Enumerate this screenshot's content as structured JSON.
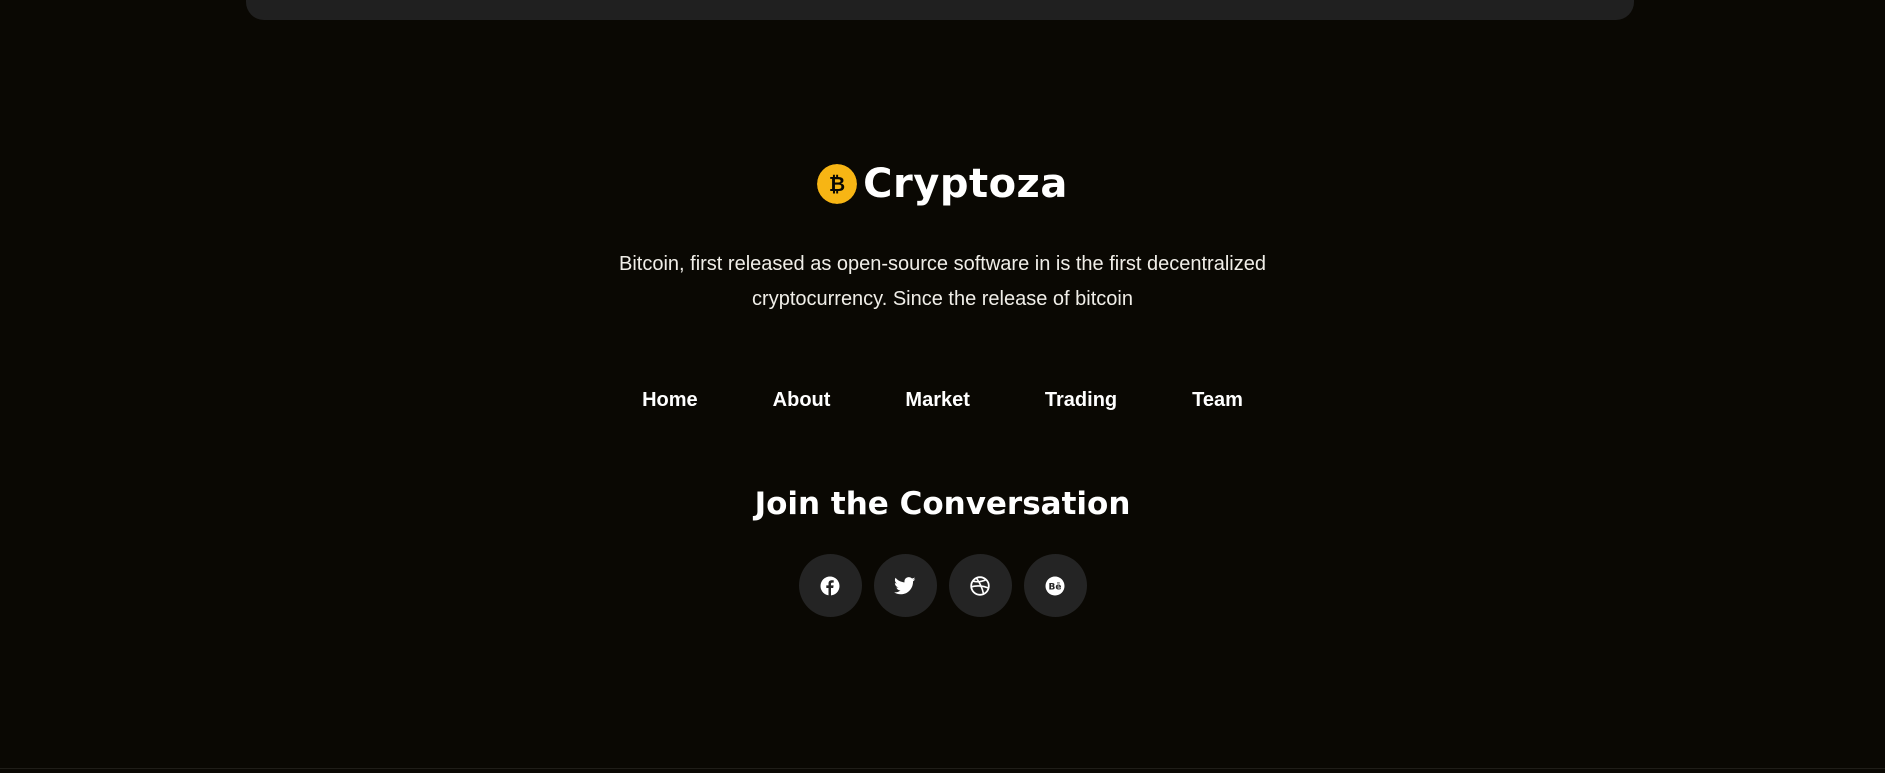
{
  "brand": {
    "name": "Cryptoza",
    "logo_icon": "bitcoin-coin-icon",
    "accent_color": "#f7b514"
  },
  "description": {
    "line1": "Bitcoin, first released as open-source software in is the first decentralized",
    "line2": "cryptocurrency. Since the release of bitcoin"
  },
  "nav": {
    "items": [
      {
        "label": "Home"
      },
      {
        "label": "About"
      },
      {
        "label": "Market"
      },
      {
        "label": "Trading"
      },
      {
        "label": "Team"
      }
    ]
  },
  "social": {
    "heading": "Join the Conversation",
    "icons": [
      "facebook-icon",
      "twitter-icon",
      "dribbble-icon",
      "behance-icon"
    ]
  },
  "colors": {
    "background": "#0a0803",
    "card": "#202020",
    "social_button": "#242424",
    "text": "#ffffff"
  }
}
